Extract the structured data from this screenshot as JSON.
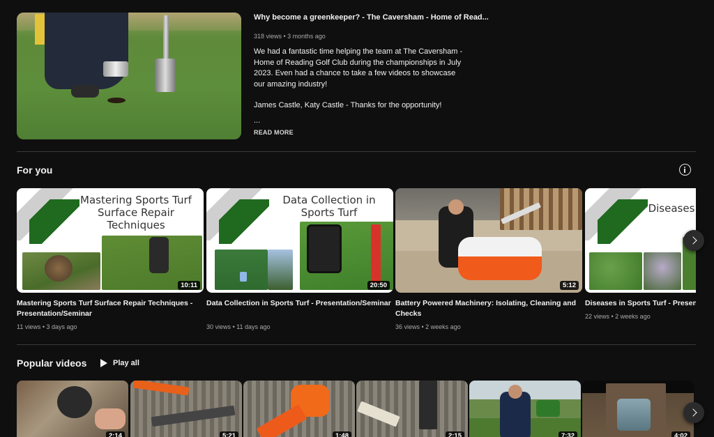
{
  "featured": {
    "title": "Why become a greenkeeper? - The Caversham - Home of Read...",
    "meta": "318 views • 3 months ago",
    "desc1": "We had a fantastic time helping the team at The Caversham - Home of Reading Golf Club during the championships in July 2023. Even had a chance to take a few videos to showcase our amazing industry!",
    "desc2": "James Castle, Katy Castle - Thanks for the opportunity!",
    "ellipsis": "...",
    "read_more": "READ MORE"
  },
  "for_you": {
    "title": "For you",
    "cards": [
      {
        "thumb_text": "Mastering Sports Turf Surface Repair Techniques",
        "duration": "10:11",
        "title": "Mastering Sports Turf Surface Repair Techniques - Presentation/Seminar",
        "meta": "11 views • 3 days ago"
      },
      {
        "thumb_text": "Data Collection in Sports Turf",
        "duration": "20:50",
        "title": "Data Collection in Sports Turf - Presentation/Seminar",
        "meta": "30 views • 11 days ago"
      },
      {
        "thumb_text": "",
        "duration": "5:12",
        "title": "Battery Powered Machinery: Isolating, Cleaning and Checks",
        "meta": "36 views • 2 weeks ago"
      },
      {
        "thumb_text": "Diseases",
        "duration": "",
        "title": "Diseases in Sports Turf - Presentation/Seminar",
        "meta": "22 views • 2 weeks ago"
      }
    ]
  },
  "popular": {
    "title": "Popular videos",
    "play_all": "Play all",
    "durations": [
      "2:14",
      "5:21",
      "1:48",
      "2:15",
      "7:32",
      "4:02"
    ]
  }
}
